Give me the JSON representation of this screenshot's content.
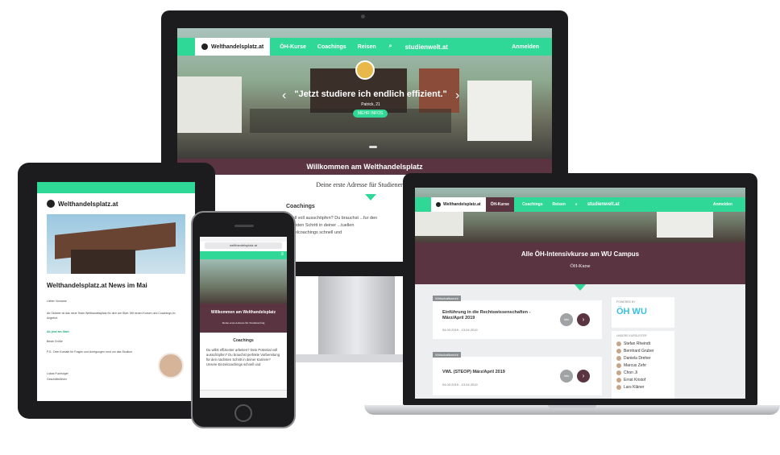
{
  "colors": {
    "accent": "#2fd897",
    "maroon": "#5b3442",
    "frame": "#1c1c1e"
  },
  "site": {
    "logo": "Welthandelsplatz.at",
    "nav": [
      "ÖH-Kurse",
      "Coachings",
      "Reisen"
    ],
    "partner": "studienwelt.at",
    "login": "Anmelden"
  },
  "monitor": {
    "quote": "\"Jetzt studiere ich endlich effizient.\"",
    "quote_author": "Patrick, 21",
    "cta": "MEHR INFOS",
    "welcome": "Willkommen am Welthandelsplatz",
    "tagline": "Deine erste Adresse für Studienerfolg",
    "coachings_title": "Coachings",
    "coachings_text": "...tfall voll ausschöpfen? Du brauchst ...fur den nächsten Schritt in deiner ...tuellen Einzelcoachings schnell und"
  },
  "laptop": {
    "title": "Alle ÖH-Intensivkurse am WU Campus",
    "subtitle": "ÖH-Kurse",
    "badge": "Wirtschaftsrecht",
    "courses": [
      {
        "label": "Einführung in die Rechtswissenschaften - März/April 2019",
        "dates": "04.03.2019 - 13.04.2019",
        "btn": "Info"
      },
      {
        "label": "VWL (STEOP) März/April 2019",
        "dates": "04.03.2019 - 13.04.2019",
        "btn": "Info"
      }
    ],
    "powered": "POWERED BY",
    "partner_logo": "ÖH WU",
    "team_title": "UNSERE KURSLEITER",
    "team": [
      "Stefan Rheindt",
      "Bernhard Gruber",
      "Daniela Dreher",
      "Marcus Zehr",
      "Chon Ji",
      "Ernst Kristof",
      "Lars Kläner"
    ]
  },
  "tablet": {
    "logo": "Welthandelsplatz.at",
    "headline": "Welthandelsplatz.at News im Mai",
    "greeting": "Lieber Vorname",
    "body": "Ab Oktober ist das neue Team Welthandelsplatz für dich am Start. Mit neuen Kursen und Coachings im Angebot.",
    "more": "Ab jetzt am Start",
    "regards": "Beste Grüße",
    "ps": "P.S.: Dein Kontakt für Fragen und Anregungen rund um das Studium",
    "sig": "Lukas Fuchsöger",
    "sig2": "Geschäftsführer"
  },
  "phone": {
    "url": "welthandelsplatz.at",
    "welcome": "Willkommen am Welthandelsplatz",
    "tagline": "Deine erste Adresse für Studienerfolg",
    "coachings_title": "Coachings",
    "coachings_text": "Du willst effizienter arbeiten? Dein Potential voll ausschöpfen? Du brauchst perfekte Vorbereitung für den nächsten Schritt in deiner Karriere? Unsere Einzelcoachings schnell und"
  }
}
